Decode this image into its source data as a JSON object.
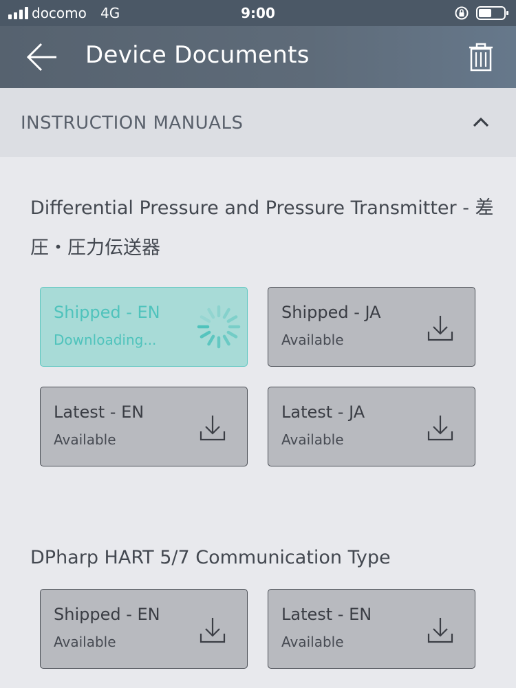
{
  "status_bar": {
    "carrier": "docomo",
    "network": "4G",
    "time": "9:00",
    "battery_level": 0.5
  },
  "header": {
    "title": "Device Documents",
    "back_icon": "back-arrow-icon",
    "trash_icon": "trash-icon"
  },
  "section": {
    "label": "INSTRUCTION MANUALS",
    "expanded": true
  },
  "groups": [
    {
      "title": "Differential Pressure and Pressure Transmitter - 差圧・圧力伝送器",
      "documents": [
        {
          "label": "Shipped - EN",
          "status": "Downloading...",
          "state": "downloading"
        },
        {
          "label": "Shipped - JA",
          "status": "Available",
          "state": "available"
        },
        {
          "label": "Latest - EN",
          "status": "Available",
          "state": "available"
        },
        {
          "label": "Latest - JA",
          "status": "Available",
          "state": "available"
        }
      ]
    },
    {
      "title": "DPharp HART 5/7 Communication Type",
      "documents": [
        {
          "label": "Shipped - EN",
          "status": "Available",
          "state": "available"
        },
        {
          "label": "Latest - EN",
          "status": "Available",
          "state": "available"
        }
      ]
    }
  ],
  "colors": {
    "header_bg": "#5e6b79",
    "downloading_accent": "#4fc3bc",
    "button_bg": "#b8babf"
  }
}
